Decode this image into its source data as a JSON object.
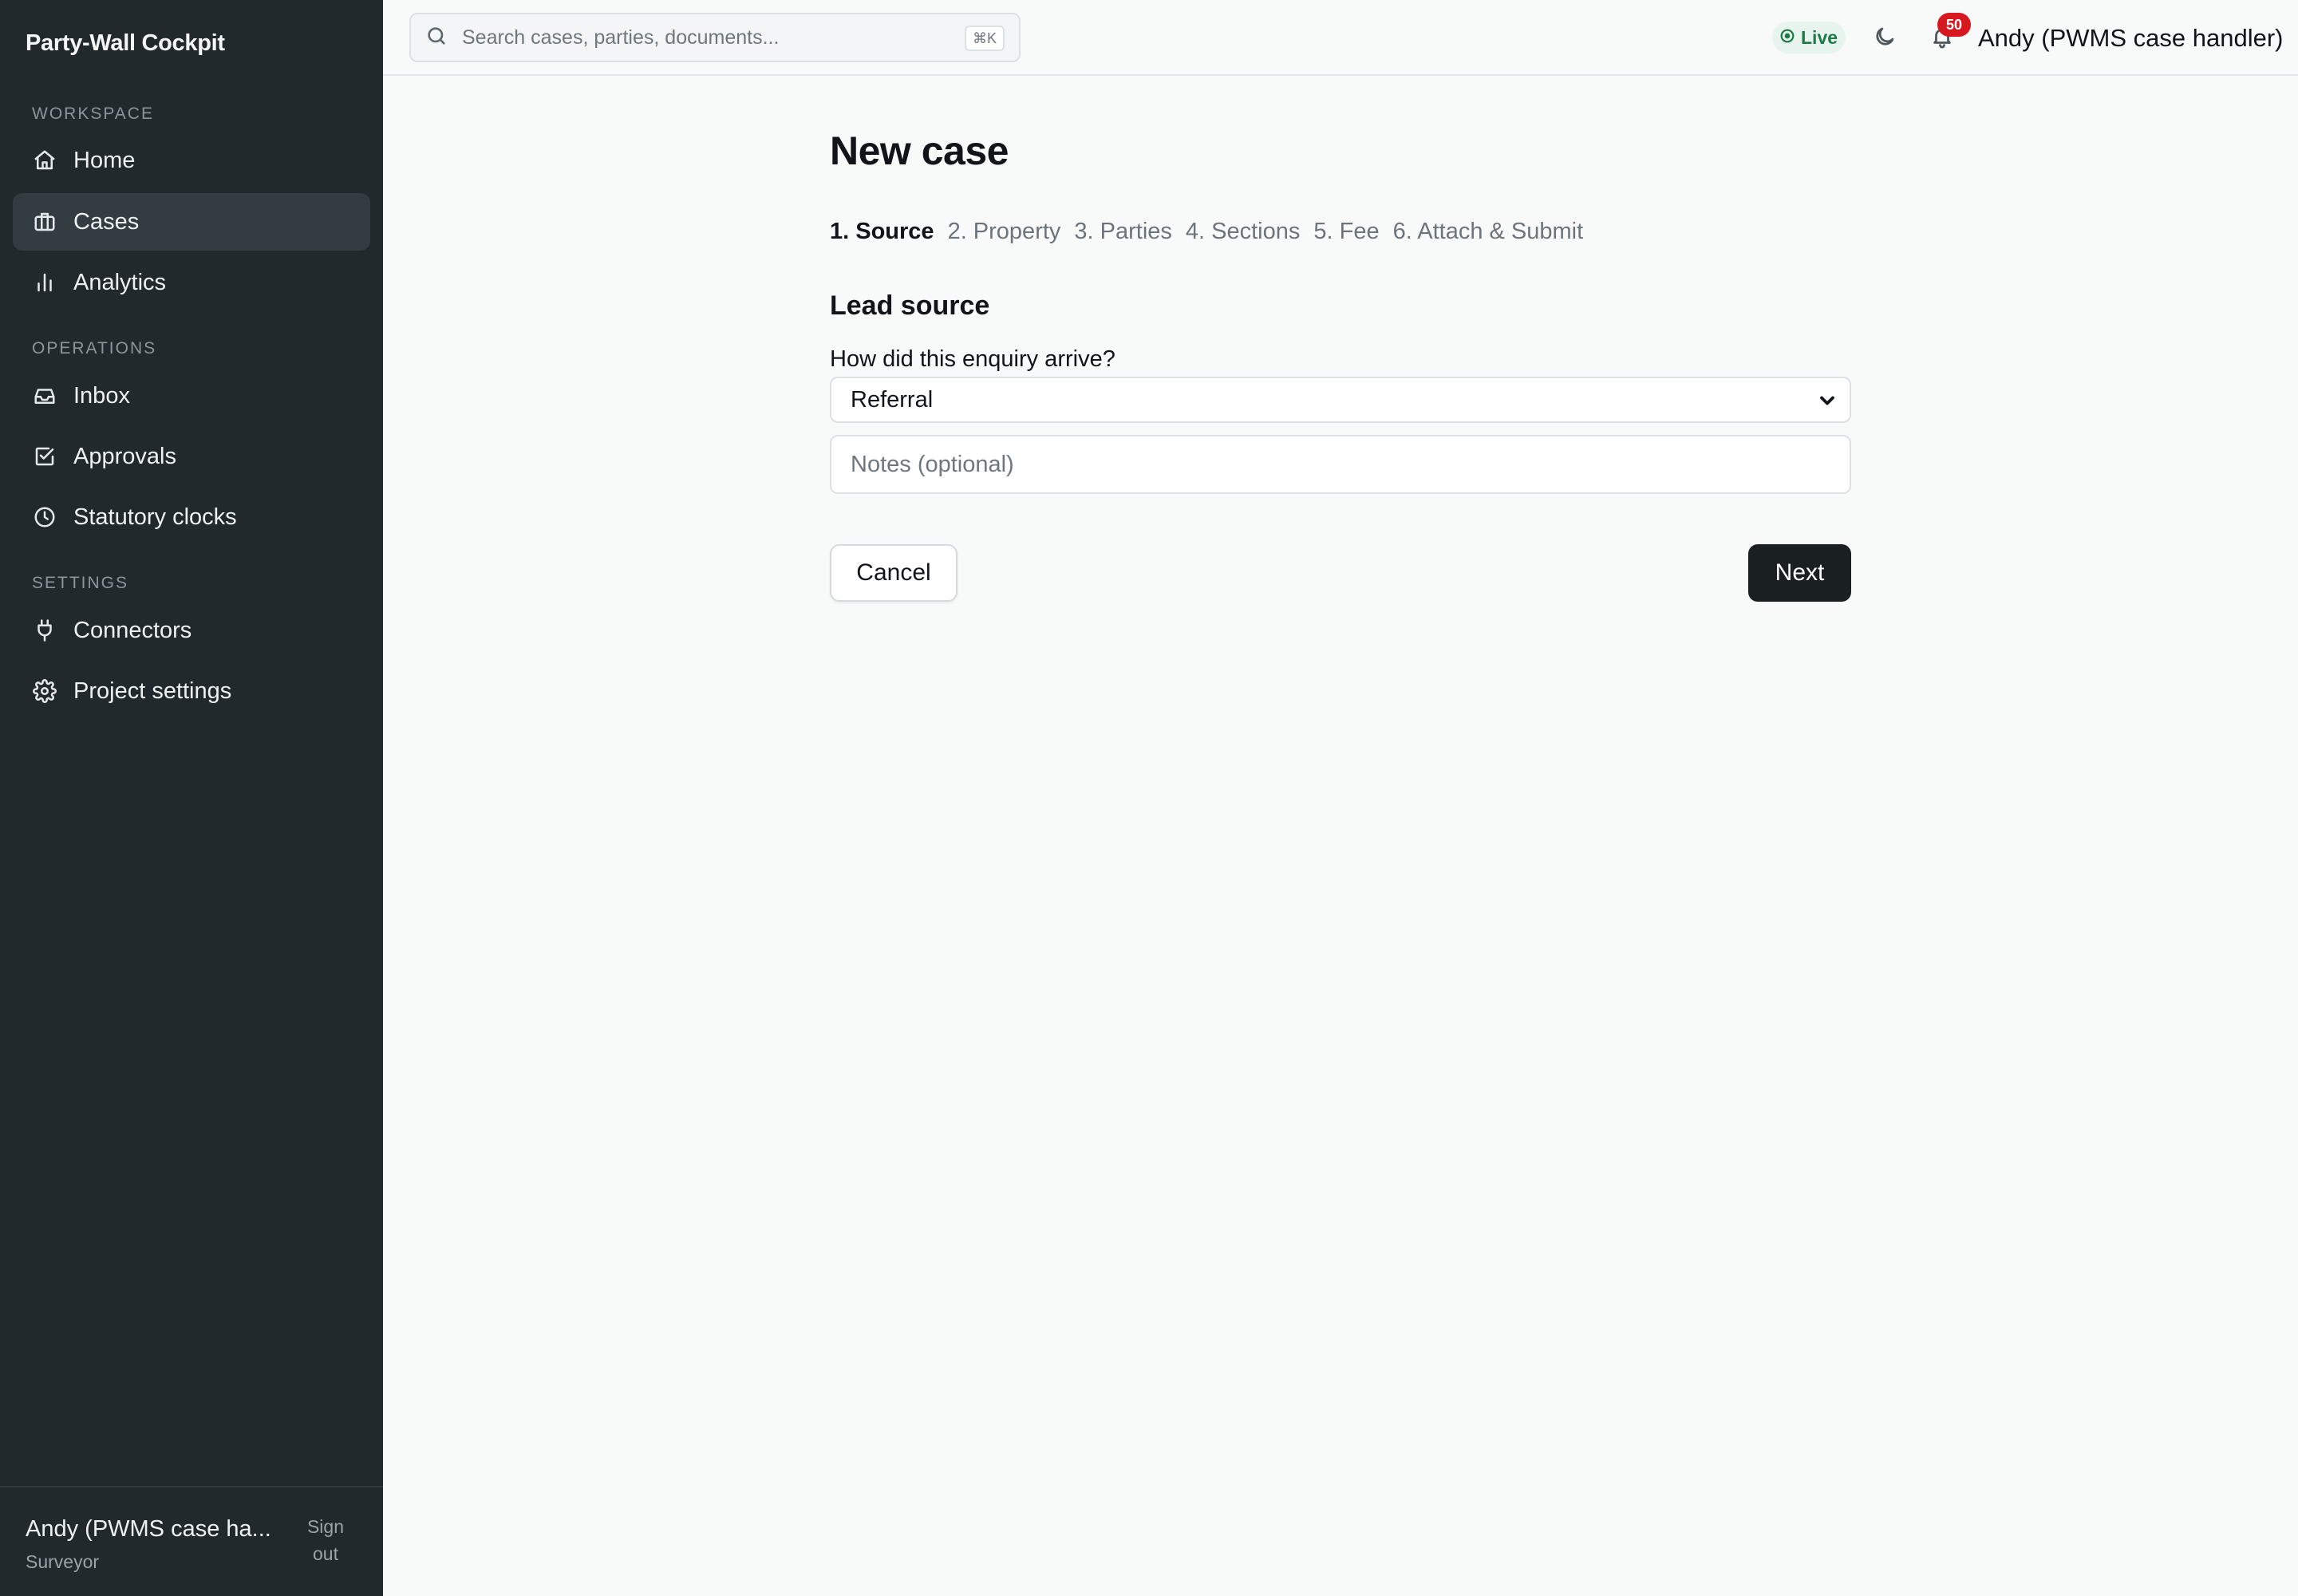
{
  "app": {
    "brand": "Party-Wall Cockpit"
  },
  "sidebar": {
    "sections": [
      {
        "label": "WORKSPACE"
      },
      {
        "label": "OPERATIONS"
      },
      {
        "label": "SETTINGS"
      }
    ],
    "items": [
      {
        "label": "Home",
        "icon": "home-icon"
      },
      {
        "label": "Cases",
        "icon": "briefcase-icon",
        "active": true
      },
      {
        "label": "Analytics",
        "icon": "bar-chart-icon"
      },
      {
        "label": "Inbox",
        "icon": "inbox-icon"
      },
      {
        "label": "Approvals",
        "icon": "check-square-icon"
      },
      {
        "label": "Statutory clocks",
        "icon": "clock-icon"
      },
      {
        "label": "Connectors",
        "icon": "plug-icon"
      },
      {
        "label": "Project settings",
        "icon": "gear-icon"
      }
    ],
    "footer": {
      "user_name": "Andy (PWMS case ha...",
      "role": "Surveyor",
      "signout_line1": "Sign",
      "signout_line2": "out"
    }
  },
  "topbar": {
    "search_placeholder": "Search cases, parties, documents...",
    "shortcut": "⌘K",
    "status": "Live",
    "notification_count": "50",
    "user_name": "Andy (PWMS case handler)"
  },
  "main": {
    "title": "New case",
    "steps": [
      {
        "label": "1. Source",
        "active": true
      },
      {
        "label": "2. Property"
      },
      {
        "label": "3. Parties"
      },
      {
        "label": "4. Sections"
      },
      {
        "label": "5. Fee"
      },
      {
        "label": "6. Attach & Submit"
      }
    ],
    "section_title": "Lead source",
    "field_label": "How did this enquiry arrive?",
    "select_value": "Referral",
    "notes_placeholder": "Notes (optional)",
    "cancel_label": "Cancel",
    "next_label": "Next"
  },
  "colors": {
    "sidebar_bg": "#22292c",
    "primary_button": "#1a1f22",
    "live_green": "#1d7a46",
    "badge_red": "#d7191f"
  }
}
